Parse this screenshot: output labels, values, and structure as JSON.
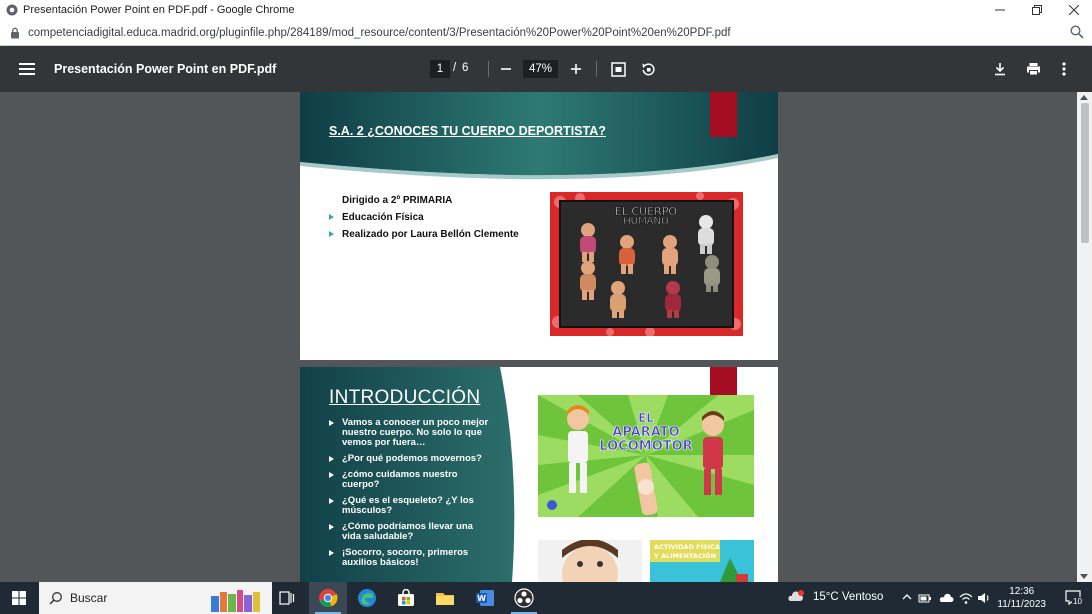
{
  "window": {
    "title": "Presentación Power Point en PDF.pdf - Google Chrome"
  },
  "address": {
    "url": "competenciadigital.educa.madrid.org/pluginfile.php/284189/mod_resource/content/3/Presentación%20Power%20Point%20en%20PDF.pdf"
  },
  "pdf_toolbar": {
    "title": "Presentación Power Point en PDF.pdf",
    "current_page": "1",
    "separator": "/",
    "total_pages": "6",
    "zoom": "47%",
    "zoom_out": "−",
    "zoom_in": "+"
  },
  "slide1": {
    "heading": "S.A. 2 ¿CONOCES TU CUERPO DEPORTISTA?",
    "bullets": [
      "Dirigido a 2º PRIMARIA",
      "Educación Física",
      "Realizado por Laura Bellón Clemente"
    ],
    "image_text_line1": "EL CUERPO",
    "image_text_line2": "HUMANO"
  },
  "slide2": {
    "title": "INTRODUCCIÓN",
    "bullets": [
      "Vamos a conocer un poco mejor nuestro cuerpo. No solo lo que vemos por fuera…",
      " ¿Por qué podemos movernos?",
      " ¿cómo cuidamos nuestro cuerpo?",
      "¿Qué es el esqueleto? ¿Y los músculos?",
      "¿Cómo podríamos llevar una vida saludable?",
      "¡Socorro, socorro, primeros auxilios básicos!"
    ],
    "image_text_line1": "EL",
    "image_text_line2": "APARATO",
    "image_text_line3": "LOCOMOTOR",
    "thumb_label_line1": "ACTIVIDAD FÍSICA",
    "thumb_label_line2": "Y ALIMENTACIÓN"
  },
  "taskbar": {
    "search_placeholder": "Buscar",
    "weather": "15°C  Ventoso",
    "time": "12:36",
    "date": "11/11/2023",
    "notification_count": "10"
  },
  "colors": {
    "teal_dark": "#0f3d46",
    "teal": "#2a6e6e",
    "ribbon_red": "#a50d22",
    "viewer_bg": "#525659",
    "pdf_toolbar": "#323639",
    "taskbar": "#1f2a34"
  }
}
